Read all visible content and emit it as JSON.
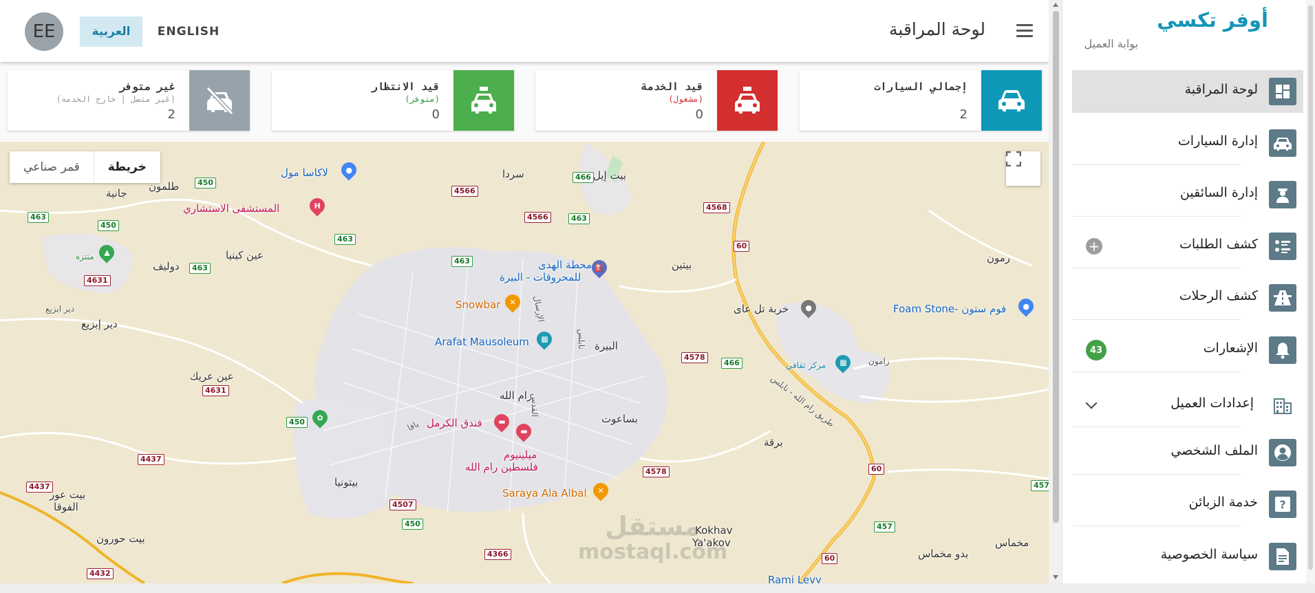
{
  "header": {
    "page_title": "لوحة المراقبة",
    "avatar_initials": "EE",
    "lang_arabic": "العربية",
    "lang_english": "ENGLISH"
  },
  "cards": [
    {
      "label": "إجمالي السيارات",
      "sub": "",
      "value": "2",
      "color": "#0f99b9",
      "icon": "car-icon"
    },
    {
      "label": "قيد الخدمة",
      "sub": "(مشغول)",
      "sub_color": "#d32f2f",
      "value": "0",
      "color": "#d32f2f",
      "icon": "taxi-icon"
    },
    {
      "label": "قيد الانتظار",
      "sub": "(متوفر)",
      "sub_color": "#2e9e3e",
      "value": "0",
      "color": "#4cae4c",
      "icon": "taxi-icon"
    },
    {
      "label": "غير متوفر",
      "sub": "(غير متصل | خارج الخدمة)",
      "sub_color": "#999999",
      "value": "2",
      "color": "#97a3ab",
      "icon": "car-off-icon"
    }
  ],
  "map": {
    "toggle_map": "خريطة",
    "toggle_satellite": "قمر صناعي",
    "labels": {
      "l1": "لاكاسا مول",
      "l2": "المستشفى الاستشاري",
      "l3": "طلمون",
      "l4": "جانية",
      "l5": "سردا",
      "l6": "بيت إيل",
      "l7": "عين كينيا",
      "l8": "دوليف",
      "l9": "منتزه",
      "l10": "محطة الهدى",
      "l11": "للمحروقات - البيرة",
      "l12": "Snowbar",
      "l13": "Arafat Mausoleum",
      "l14": "البيرة",
      "l15": "بيتين",
      "l16": "خربة تل عاى",
      "l17": "Foam Stone- فوم ستون",
      "l18": "رمون",
      "l19": "مركز ثقافي",
      "l20": "دير إبزيع",
      "l21": "عين عريك",
      "l22": "رام الله",
      "l23": "فندق الكرمل",
      "l24": "ميلينيوم",
      "l25": "فلسطين رام الله",
      "l26": "بساعوت",
      "l27": "برقة",
      "l28": "بيتونيا",
      "l29": "بيت عور",
      "l30": "الفوقا",
      "l31": "بيت حورون",
      "l32": "Saraya Ala Albal",
      "l33": "Kokhav",
      "l34": "Ya'akov",
      "l35": "بدو مخماس",
      "l36": "مخماس",
      "l37": "Rami Levy",
      "l38": "طريق رام الله - نابلس",
      "l39": "دير ابزيع",
      "l40": "الإرسال",
      "l41": "نابلس",
      "l42": "القدس",
      "l43": "رامون",
      "l44": "يافا",
      "l45": "مستقل",
      "l46": "mostaql.com"
    },
    "shields": [
      "450",
      "463",
      "450",
      "463",
      "4631",
      "4566",
      "466",
      "4566",
      "463",
      "463",
      "463",
      "4568",
      "60",
      "4578",
      "466",
      "4631",
      "450",
      "4437",
      "4437",
      "4507",
      "450",
      "4578",
      "60",
      "457",
      "457",
      "4366",
      "4432",
      "60"
    ]
  },
  "sidebar": {
    "brand": "أوفر تكسي",
    "subtitle": "بوابة العميل",
    "items": [
      {
        "label": "لوحة المراقبة"
      },
      {
        "label": "إدارة السيارات"
      },
      {
        "label": "إدارة السائقين"
      },
      {
        "label": "كشف الطلبات"
      },
      {
        "label": "كشف الرحلات"
      },
      {
        "label": "الإشعارات",
        "badge": "43"
      },
      {
        "label": "إعدادات العميل"
      },
      {
        "label": "الملف الشخصي"
      },
      {
        "label": "خدمة الزبائن"
      },
      {
        "label": "سياسة الخصوصية"
      }
    ]
  }
}
